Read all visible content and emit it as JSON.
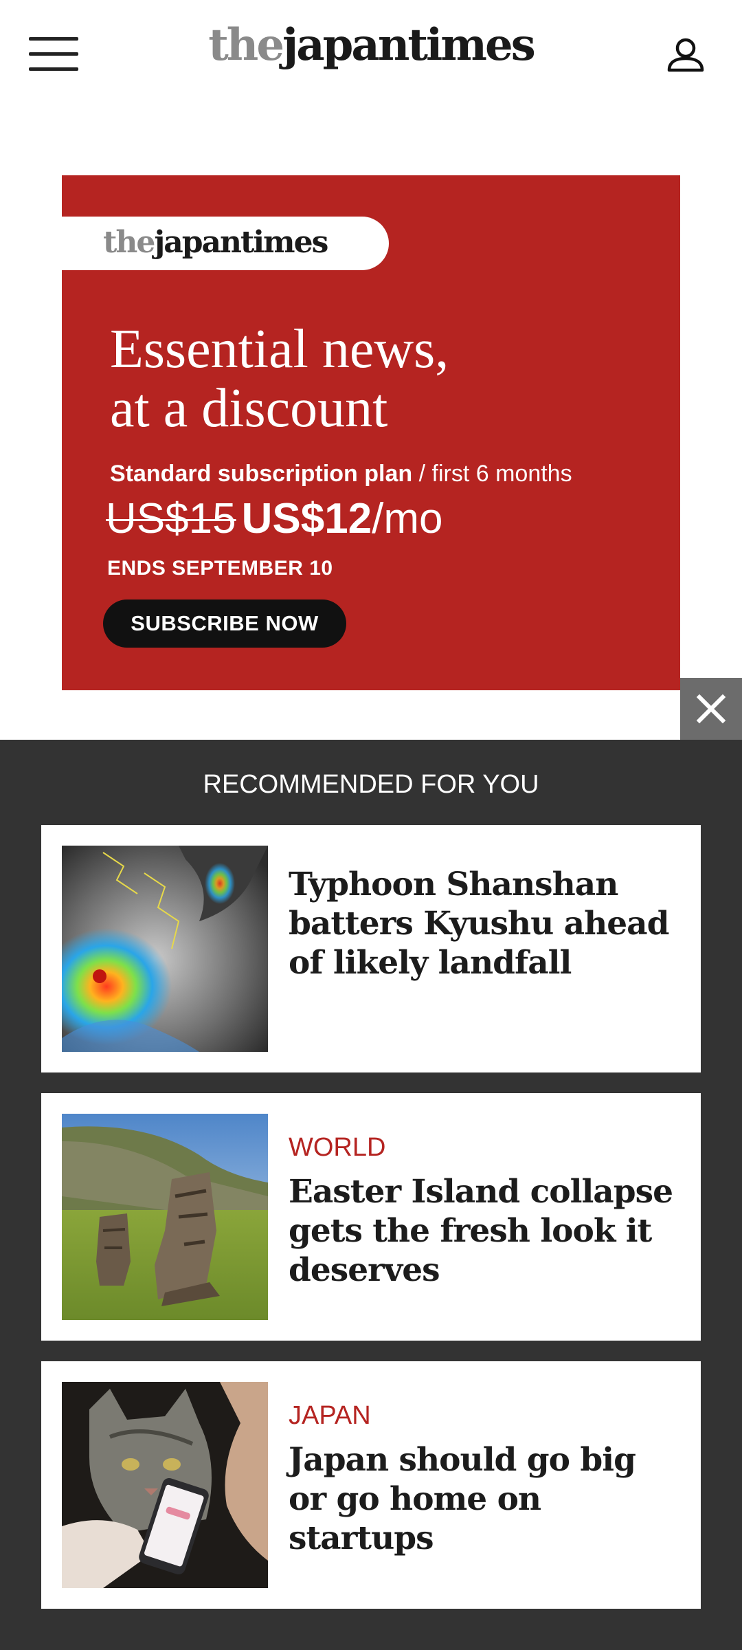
{
  "header": {
    "logo_the": "the",
    "logo_japan": "japan",
    "logo_times": "times"
  },
  "ad": {
    "logo_the": "the",
    "logo_japan": "japan",
    "logo_times": "times",
    "headline_line1": "Essential news,",
    "headline_line2": "at a discount",
    "plan_bold": "Standard subscription plan",
    "plan_rest": " / first 6 months",
    "price_old": "US$15",
    "price_new": "US$12",
    "price_unit": "/mo",
    "ends": "ENDS SEPTEMBER 10",
    "cta": "SUBSCRIBE NOW",
    "background_color": "#b52421"
  },
  "recommended": {
    "title": "RECOMMENDED FOR YOU",
    "items": [
      {
        "category": "",
        "headline": "Typhoon Shanshan batters Kyushu ahead of likely landfall",
        "image": "typhoon-satellite"
      },
      {
        "category": "WORLD",
        "headline": "Easter Island collapse gets the fresh look it deserves",
        "image": "moai-statues"
      },
      {
        "category": "JAPAN",
        "headline": "Japan should go big or go home on startups",
        "image": "cat-smartphone"
      }
    ]
  },
  "icons": {
    "menu": "hamburger-icon",
    "account": "user-icon",
    "close": "close-icon"
  }
}
